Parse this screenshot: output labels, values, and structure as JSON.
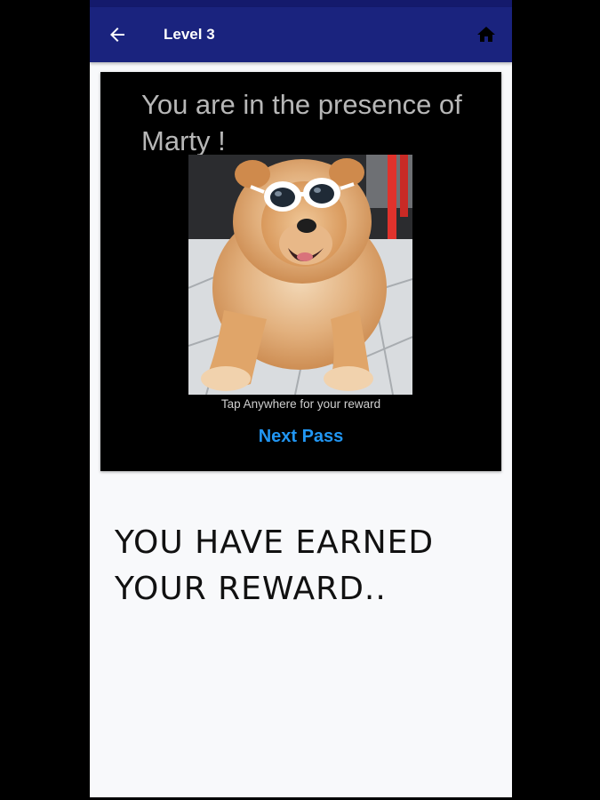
{
  "app_bar": {
    "title": "Level 3",
    "back_icon": "arrow-back-icon",
    "home_icon": "home-icon",
    "color": "#1a237e"
  },
  "card": {
    "message": "You are in the presence of Marty !",
    "image_subject": "dog-with-white-sunglasses",
    "hint": "Tap Anywhere for your reward",
    "next_pass_label": "Next Pass",
    "link_color": "#2196f3"
  },
  "reward": {
    "message": "YOU HAVE EARNED YOUR REWARD.."
  }
}
